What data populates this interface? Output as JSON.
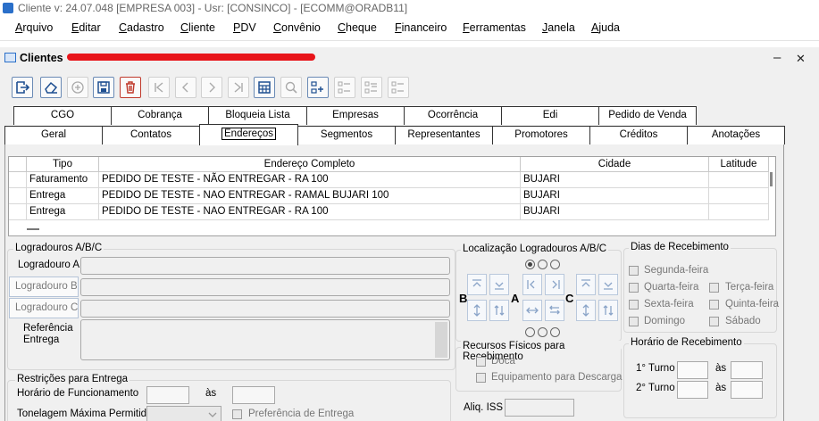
{
  "titlebar": {
    "text": "Cliente  v: 24.07.048   [EMPRESA 003] - Usr: [CONSINCO] - [ECOMM@ORADB11]"
  },
  "menu": [
    "Arquivo",
    "Editar",
    "Cadastro",
    "Cliente",
    "PDV",
    "Convênio",
    "Cheque",
    "Financeiro",
    "Ferramentas",
    "Janela",
    "Ajuda"
  ],
  "window": {
    "title": "Clientes",
    "minimize": "–",
    "close": "✕"
  },
  "tabs_row1": [
    "CGO",
    "Cobrança",
    "Bloqueia Lista",
    "Empresas",
    "Ocorrência",
    "Edi",
    "Pedido de Venda"
  ],
  "tabs_row2": [
    "Geral",
    "Contatos",
    "Endereços",
    "Segmentos",
    "Representantes",
    "Promotores",
    "Créditos",
    "Anotações"
  ],
  "grid": {
    "columns": [
      "Tipo",
      "Endereço Completo",
      "Cidade",
      "Latitude"
    ],
    "rows": [
      [
        "Faturamento",
        "PEDIDO DE TESTE - NÃO ENTREGAR - RA 100",
        "BUJARI",
        ""
      ],
      [
        "Entrega",
        "PEDIDO DE TESTE - NAO ENTREGAR - RAMAL BUJARI 100",
        "BUJARI",
        ""
      ],
      [
        "Entrega",
        "PEDIDO DE TESTE - NAO ENTREGAR - RA 100",
        "BUJARI",
        ""
      ]
    ]
  },
  "logradouros": {
    "legend": "Logradouros A/B/C",
    "a": "Logradouro A",
    "b": "Logradouro B",
    "c": "Logradouro C",
    "ref": "Referência Entrega",
    "ref1": "Referência",
    "ref2": "Entrega"
  },
  "localizacao": {
    "legend": "Localização Logradouros A/B/C",
    "b": "B",
    "a": "A",
    "c": "C"
  },
  "dias": {
    "legend": "Dias de Recebimento",
    "items": [
      "Segunda-feira",
      "Quarta-feira",
      "Terça-feira",
      "Sexta-feira",
      "Quinta-feira",
      "Domingo",
      "Sábado"
    ]
  },
  "recursos": {
    "legend": "Recursos Físicos para Recebimento",
    "doca": "Doca",
    "equip": "Equipamento para Descarga"
  },
  "horario": {
    "legend": "Horário de Recebimento",
    "turno1": "1° Turno",
    "turno2": "2° Turno",
    "as": "às"
  },
  "restricoes": {
    "legend": "Restrições para Entrega",
    "horario": "Horário de Funcionamento",
    "as": "às",
    "tonelagem": "Tonelagem Máxima Permitida",
    "preferencia": "Preferência de Entrega"
  },
  "aliq": {
    "label": "Aliq. ISS"
  }
}
